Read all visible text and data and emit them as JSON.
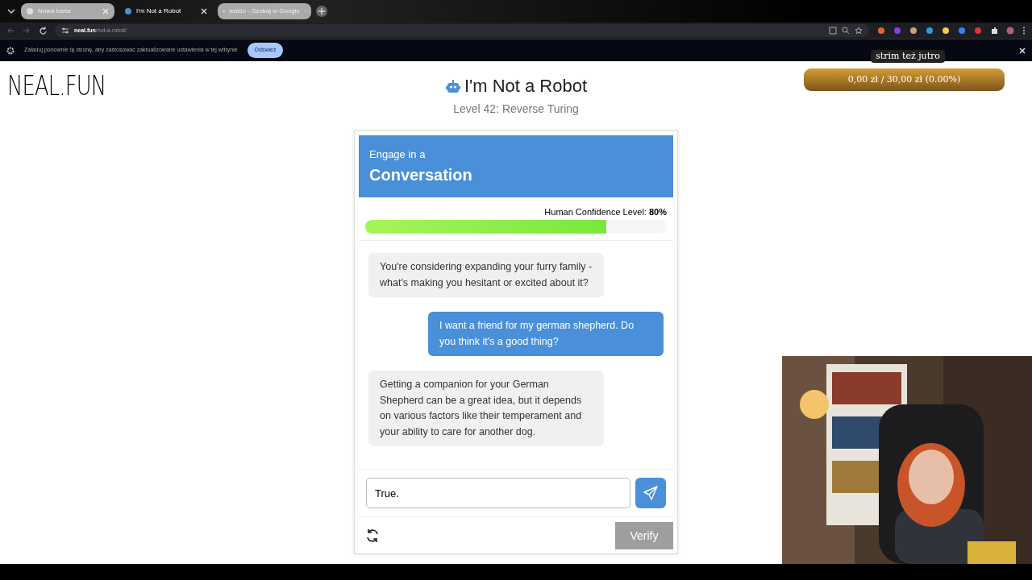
{
  "browser": {
    "tabs": [
      {
        "title": "Nowa karta",
        "selected": false
      },
      {
        "title": "I'm Not a Robot",
        "selected": true
      },
      {
        "title": "waldo - Szukaj w Google",
        "selected": false
      }
    ],
    "address": {
      "host": "neal.fun",
      "path": "/not-a-robot/"
    },
    "infobar": {
      "message": "Załaduj ponownie tę stronę, aby zastosować zaktualizowane ustawienia w tej witrynie",
      "button": "Odśwież"
    }
  },
  "page": {
    "logo": "NEAL.FUN",
    "title": "I'm Not a Robot",
    "subtitle": "Level 42: Reverse Turing",
    "card": {
      "header_small": "Engage in a",
      "header_big": "Conversation",
      "confidence_label": "Human Confidence Level:",
      "confidence_value": "80%",
      "level": 0.8,
      "messages": [
        {
          "kind": "bot",
          "text": "You're considering expanding your furry family - what's making you hesitant or excited about it?"
        },
        {
          "kind": "user",
          "text": "I want a friend for my german shepherd. Do you think it's a good thing?"
        },
        {
          "kind": "bot",
          "text": "Getting a companion for your German Shepherd can be a great idea, but it depends on various factors like their temperament and your ability to care for another dog."
        }
      ],
      "input_value": "True. ",
      "verify": {
        "label": "Verify",
        "disabled": true
      }
    }
  },
  "overlay": {
    "caption": "strim też jutro",
    "goal": "0,00 zł / 30,00 zł (0.00%)"
  }
}
